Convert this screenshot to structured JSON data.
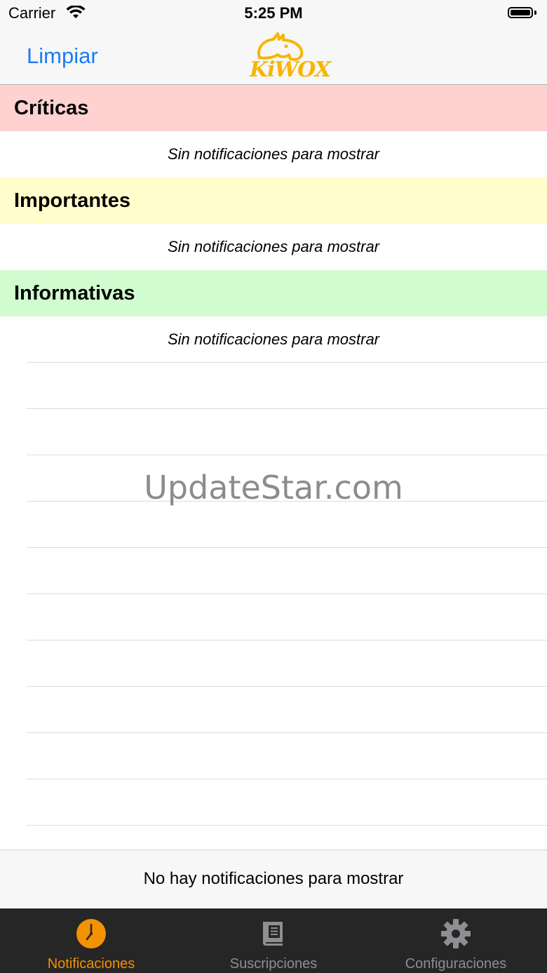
{
  "status_bar": {
    "carrier": "Carrier",
    "time": "5:25 PM"
  },
  "nav": {
    "left_button": "Limpiar",
    "logo_text": "KiWOX",
    "logo_color": "#f7b500"
  },
  "sections": [
    {
      "title": "Críticas",
      "empty_text": "Sin notificaciones para mostrar",
      "color": "#ffd1d1"
    },
    {
      "title": "Importantes",
      "empty_text": "Sin notificaciones para mostrar",
      "color": "#fffecc"
    },
    {
      "title": "Informativas",
      "empty_text": "Sin notificaciones para mostrar",
      "color": "#d0fcd0"
    }
  ],
  "watermark": "UpdateStar.com",
  "footer": {
    "message": "No hay notificaciones para mostrar"
  },
  "tabs": [
    {
      "label": "Notificaciones",
      "icon": "clock-icon",
      "active": true
    },
    {
      "label": "Suscripciones",
      "icon": "book-icon",
      "active": false
    },
    {
      "label": "Configuraciones",
      "icon": "gear-icon",
      "active": false
    }
  ],
  "colors": {
    "accent": "#1b7cf5",
    "tab_active": "#f39200",
    "tab_inactive": "#8e8e93",
    "tab_bar": "#262626"
  }
}
